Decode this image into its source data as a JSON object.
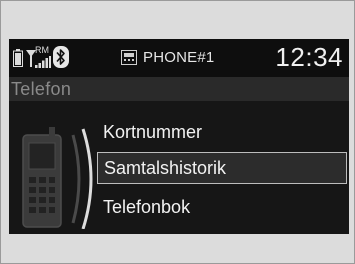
{
  "status": {
    "phone_name": "PHONE#1",
    "time": "12:34",
    "network_label": "RM"
  },
  "title": "Telefon",
  "menu": [
    {
      "label": "Kortnummer",
      "selected": false
    },
    {
      "label": "Samtalshistorik",
      "selected": true
    },
    {
      "label": "Telefonbok",
      "selected": false
    }
  ],
  "colors": {
    "screen_bg": "#161616",
    "title_bg": "#2a2a2a",
    "text": "#f2f2f2",
    "title_text": "#8a8a8a",
    "selection_border": "#bdbdbd"
  }
}
